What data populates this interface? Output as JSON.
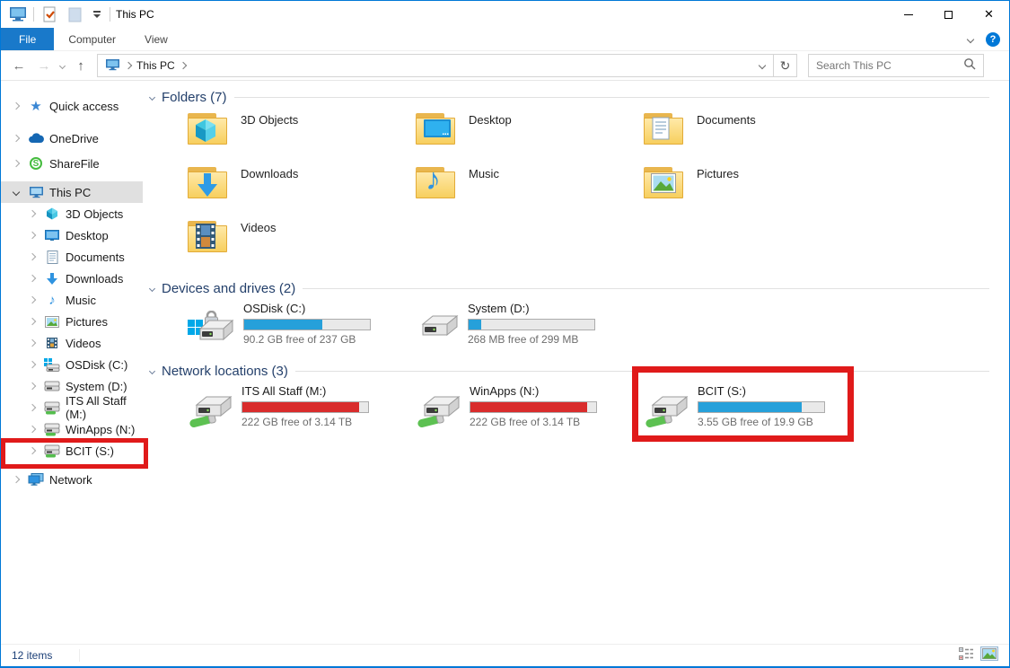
{
  "colors": {
    "accent": "#0078d7",
    "file_tab_bg": "#1979ca",
    "highlight_red": "#e01a1a",
    "bar_blue": "#26a0da",
    "bar_red": "#d92c2c",
    "selected_sidebar_bg": "#e0e0e0"
  },
  "titlebar": {
    "title": "This PC",
    "qat_icons": [
      "explorer-window-icon",
      "properties-icon",
      "new-folder-icon",
      "customize-quick-access-icon"
    ],
    "window_control_icons": [
      "minimize-icon",
      "maximize-icon",
      "close-icon"
    ]
  },
  "menubar": {
    "tabs": [
      "File",
      "Computer",
      "View"
    ],
    "expand_ribbon_icon": "chevron-down-icon",
    "help_label": "?"
  },
  "toolbar": {
    "nav_icons": [
      "back-icon",
      "forward-icon",
      "recent-locations-icon",
      "up-icon"
    ],
    "breadcrumb": {
      "root_icon": "this-pc-icon",
      "path": [
        "This PC"
      ]
    },
    "refresh_icon": "refresh-icon",
    "search": {
      "placeholder": "Search This PC"
    }
  },
  "sidebar": {
    "items": [
      {
        "label": "Quick access",
        "icon": "star-icon"
      },
      {
        "label": "OneDrive",
        "icon": "cloud-icon"
      },
      {
        "label": "ShareFile",
        "icon": "sharefile-icon"
      },
      {
        "label": "This PC",
        "icon": "computer-icon",
        "selected": true,
        "expanded": true
      },
      {
        "label": "3D Objects",
        "icon": "cube-icon"
      },
      {
        "label": "Desktop",
        "icon": "monitor-icon"
      },
      {
        "label": "Documents",
        "icon": "document-icon"
      },
      {
        "label": "Downloads",
        "icon": "download-arrow-icon"
      },
      {
        "label": "Music",
        "icon": "music-note-icon"
      },
      {
        "label": "Pictures",
        "icon": "picture-icon"
      },
      {
        "label": "Videos",
        "icon": "film-icon"
      },
      {
        "label": "OSDisk (C:)",
        "icon": "os-disk-icon"
      },
      {
        "label": "System (D:)",
        "icon": "drive-icon"
      },
      {
        "label": "ITS All Staff (M:)",
        "icon": "network-drive-icon"
      },
      {
        "label": "WinApps (N:)",
        "icon": "network-drive-icon"
      },
      {
        "label": "BCIT (S:)",
        "icon": "network-drive-icon",
        "highlighted": true
      },
      {
        "label": "Network",
        "icon": "network-icon"
      }
    ]
  },
  "main": {
    "groups": [
      {
        "title": "Folders (7)"
      },
      {
        "title": "Devices and drives (2)"
      },
      {
        "title": "Network locations (3)"
      }
    ],
    "folders": [
      {
        "name": "3D Objects",
        "icon": "folder-3d-objects-icon"
      },
      {
        "name": "Desktop",
        "icon": "folder-desktop-icon"
      },
      {
        "name": "Documents",
        "icon": "folder-documents-icon"
      },
      {
        "name": "Downloads",
        "icon": "folder-downloads-icon"
      },
      {
        "name": "Music",
        "icon": "folder-music-icon"
      },
      {
        "name": "Pictures",
        "icon": "folder-pictures-icon"
      },
      {
        "name": "Videos",
        "icon": "folder-videos-icon"
      }
    ],
    "drives": [
      {
        "name": "OSDisk (C:)",
        "caption": "90.2 GB free of 237 GB",
        "used": "62%",
        "bar_color": "#26a0da",
        "icon": "os-disk-locked-icon"
      },
      {
        "name": "System (D:)",
        "caption": "268 MB free of 299 MB",
        "used": "10%",
        "bar_color": "#26a0da",
        "icon": "drive-icon"
      }
    ],
    "network": [
      {
        "name": "ITS All Staff (M:)",
        "caption": "222 GB free of 3.14 TB",
        "used": "93%",
        "bar_color": "#d92c2c",
        "icon": "network-drive-icon"
      },
      {
        "name": "WinApps (N:)",
        "caption": "222 GB free of 3.14 TB",
        "used": "93%",
        "bar_color": "#d92c2c",
        "icon": "network-drive-icon"
      },
      {
        "name": "BCIT (S:)",
        "caption": "3.55 GB free of 19.9 GB",
        "used": "82%",
        "bar_color": "#26a0da",
        "icon": "network-drive-icon",
        "highlighted": true
      }
    ]
  },
  "statusbar": {
    "items_text": "12 items",
    "view_icons": [
      "details-view-icon",
      "large-icons-view-icon"
    ]
  }
}
